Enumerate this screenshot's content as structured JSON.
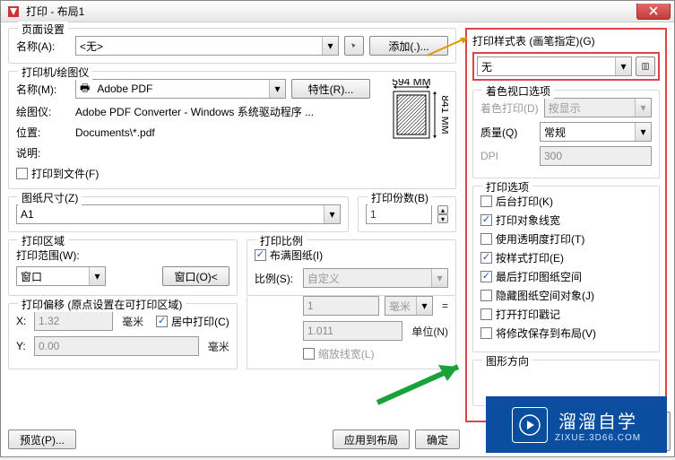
{
  "title": "打印 - 布局1",
  "page_setting": {
    "group": "页面设置",
    "name_label": "名称(A):",
    "name_value": "<无>",
    "add_btn": "添加(.)..."
  },
  "printer": {
    "group": "打印机/绘图仪",
    "name_label": "名称(M):",
    "name_value": "Adobe PDF",
    "props_btn": "特性(R)...",
    "plotter_label": "绘图仪:",
    "plotter_value": "Adobe PDF Converter - Windows 系统驱动程序 ...",
    "location_label": "位置:",
    "location_value": "Documents\\*.pdf",
    "desc_label": "说明:",
    "print_to_file": "打印到文件(F)",
    "preview_w": "594 MM",
    "preview_h": "841 MM"
  },
  "paper": {
    "group": "图纸尺寸(Z)",
    "value": "A1"
  },
  "copies": {
    "group": "打印份数(B)",
    "value": "1"
  },
  "area": {
    "group": "打印区域",
    "range_label": "打印范围(W):",
    "value": "窗口",
    "window_btn": "窗口(O)<"
  },
  "scale": {
    "group": "打印比例",
    "fit": "布满图纸(I)",
    "ratio_label": "比例(S):",
    "ratio_value": "自定义",
    "num1": "1",
    "unit1": "毫米",
    "num2": "1.011",
    "unit2": "单位(N)",
    "equals": "=",
    "scale_lineweight": "缩放线宽(L)"
  },
  "offset": {
    "group": "打印偏移 (原点设置在可打印区域)",
    "x_label": "X:",
    "x_value": "1.32",
    "y_label": "Y:",
    "y_value": "0.00",
    "unit": "毫米",
    "center": "居中打印(C)"
  },
  "footer": {
    "preview": "预览(P)...",
    "apply": "应用到布局",
    "ok": "确定"
  },
  "plot_style": {
    "group": "打印样式表 (画笔指定)(G)",
    "value": "无"
  },
  "shade": {
    "group": "着色视口选项",
    "mode_label": "着色打印(D)",
    "mode_value": "按显示",
    "quality_label": "质量(Q)",
    "quality_value": "常规",
    "dpi_label": "DPI",
    "dpi_value": "300"
  },
  "options": {
    "group": "打印选项",
    "items": [
      {
        "label": "后台打印(K)",
        "cb": false,
        "en": true
      },
      {
        "label": "打印对象线宽",
        "cb": true,
        "en": true
      },
      {
        "label": "使用透明度打印(T)",
        "cb": false,
        "en": true
      },
      {
        "label": "按样式打印(E)",
        "cb": true,
        "en": true
      },
      {
        "label": "最后打印图纸空间",
        "cb": true,
        "en": true
      },
      {
        "label": "隐藏图纸空间对象(J)",
        "cb": false,
        "en": true
      },
      {
        "label": "打开打印戳记",
        "cb": false,
        "en": true
      },
      {
        "label": "将修改保存到布局(V)",
        "cb": false,
        "en": true
      }
    ]
  },
  "orientation": {
    "group": "图形方向"
  },
  "brand": {
    "cn": "溜溜自学",
    "en": "ZIXUE.3D66.COM"
  }
}
